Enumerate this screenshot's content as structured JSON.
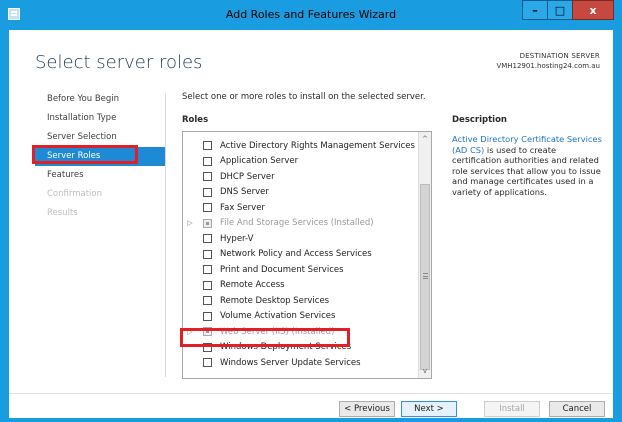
{
  "window": {
    "title": "Add Roles and Features Wizard",
    "minimize_glyph": "–",
    "maximize_glyph": "□",
    "close_glyph": "x",
    "icon": "server-manager-icon"
  },
  "header": {
    "page_title": "Select server roles",
    "destination_label": "DESTINATION SERVER",
    "destination_value": "VMH12901.hosting24.com.au"
  },
  "nav": {
    "items": [
      {
        "label": "Before You Begin",
        "state": "normal"
      },
      {
        "label": "Installation Type",
        "state": "normal"
      },
      {
        "label": "Server Selection",
        "state": "normal"
      },
      {
        "label": "Server Roles",
        "state": "active"
      },
      {
        "label": "Features",
        "state": "normal"
      },
      {
        "label": "Confirmation",
        "state": "disabled"
      },
      {
        "label": "Results",
        "state": "disabled"
      }
    ]
  },
  "main": {
    "instruction": "Select one or more roles to install on the selected server.",
    "roles_header": "Roles",
    "roles": [
      {
        "label": "Active Directory Rights Management Services",
        "installed": false,
        "expandable": false
      },
      {
        "label": "Application Server",
        "installed": false,
        "expandable": false
      },
      {
        "label": "DHCP Server",
        "installed": false,
        "expandable": false
      },
      {
        "label": "DNS Server",
        "installed": false,
        "expandable": false
      },
      {
        "label": "Fax Server",
        "installed": false,
        "expandable": false
      },
      {
        "label": "File And Storage Services (Installed)",
        "installed": true,
        "expandable": true
      },
      {
        "label": "Hyper-V",
        "installed": false,
        "expandable": false
      },
      {
        "label": "Network Policy and Access Services",
        "installed": false,
        "expandable": false
      },
      {
        "label": "Print and Document Services",
        "installed": false,
        "expandable": false
      },
      {
        "label": "Remote Access",
        "installed": false,
        "expandable": false
      },
      {
        "label": "Remote Desktop Services",
        "installed": false,
        "expandable": false
      },
      {
        "label": "Volume Activation Services",
        "installed": false,
        "expandable": false
      },
      {
        "label": "Web Server (IIS) (Installed)",
        "installed": true,
        "expandable": true
      },
      {
        "label": "Windows Deployment Services",
        "installed": false,
        "expandable": false
      },
      {
        "label": "Windows Server Update Services",
        "installed": false,
        "expandable": false
      }
    ],
    "scroll_up_glyph": "^",
    "scroll_down_glyph": "v",
    "description_header": "Description",
    "description_link": "Active Directory Certificate Services (AD CS)",
    "description_text": " is used to create certification authorities and related role services that allow you to issue and manage certificates used in a variety of applications."
  },
  "footer": {
    "previous": "< Previous",
    "next": "Next >",
    "install": "Install",
    "cancel": "Cancel"
  },
  "colors": {
    "titlebar": "#1a9ce0",
    "nav_active": "#1e8ad6",
    "highlight": "#e01f26",
    "link": "#1e73be"
  }
}
